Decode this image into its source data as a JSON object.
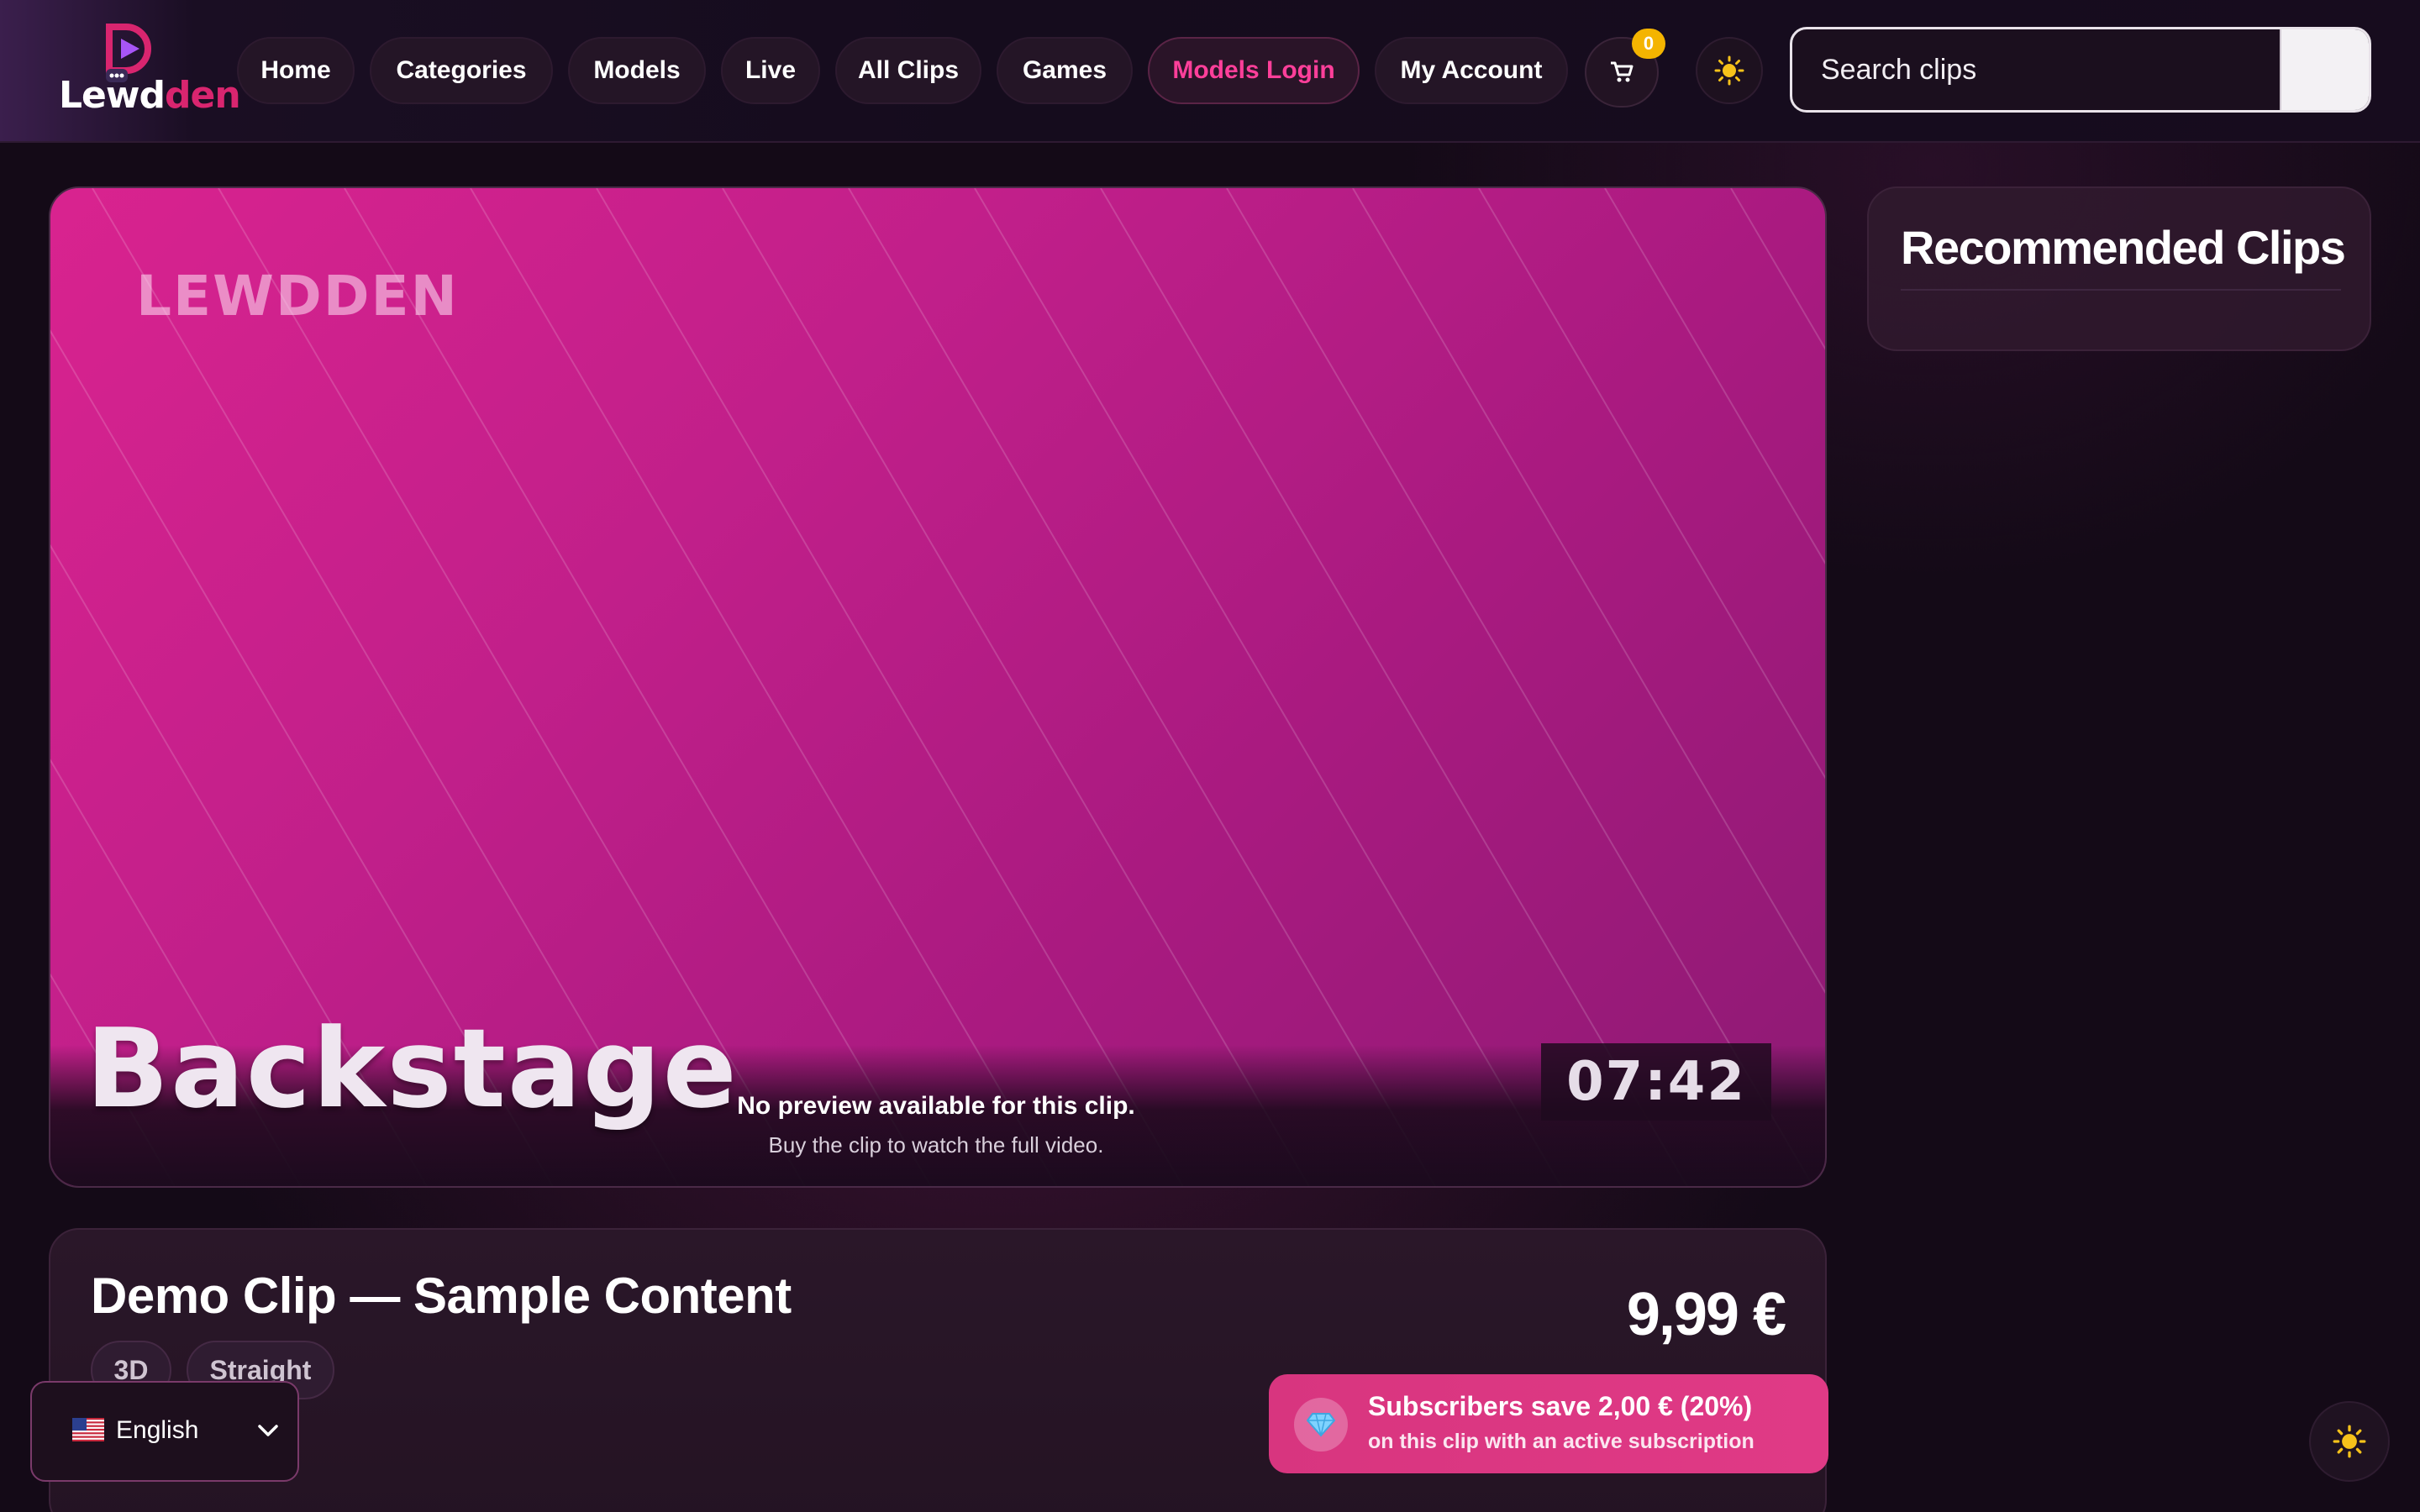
{
  "brand": {
    "name_part1": "Lewd",
    "name_part2": "den",
    "accent_color": "#d9256f"
  },
  "nav": {
    "items": [
      {
        "label": "Home"
      },
      {
        "label": "Categories"
      },
      {
        "label": "Models"
      },
      {
        "label": "Live"
      },
      {
        "label": "All Clips"
      },
      {
        "label": "Games"
      },
      {
        "label": "Models Login"
      },
      {
        "label": "My Account"
      }
    ],
    "cart_icon": "cart-icon",
    "cart_count": "0",
    "theme_icon": "sun-icon"
  },
  "search": {
    "placeholder": "Search clips",
    "button_icon": "search-icon"
  },
  "video": {
    "watermark": "LEWDDEN",
    "title_overlay": "Backstage",
    "duration": "07:42",
    "no_preview_title": "No preview available for this clip.",
    "no_preview_subtitle": "Buy the clip to watch the full video."
  },
  "sidebar": {
    "recommended_title": "Recommended Clips"
  },
  "clip": {
    "title": "Demo Clip — Sample Content",
    "tags": [
      "3D",
      "Straight"
    ],
    "price": "9,99 €",
    "subscription": {
      "line1": "Subscribers save 2,00 € (20%)",
      "line2": "on this clip with an active subscription",
      "icon": "diamond-icon"
    }
  },
  "language": {
    "label": "English",
    "flag_icon": "us-flag-icon"
  }
}
